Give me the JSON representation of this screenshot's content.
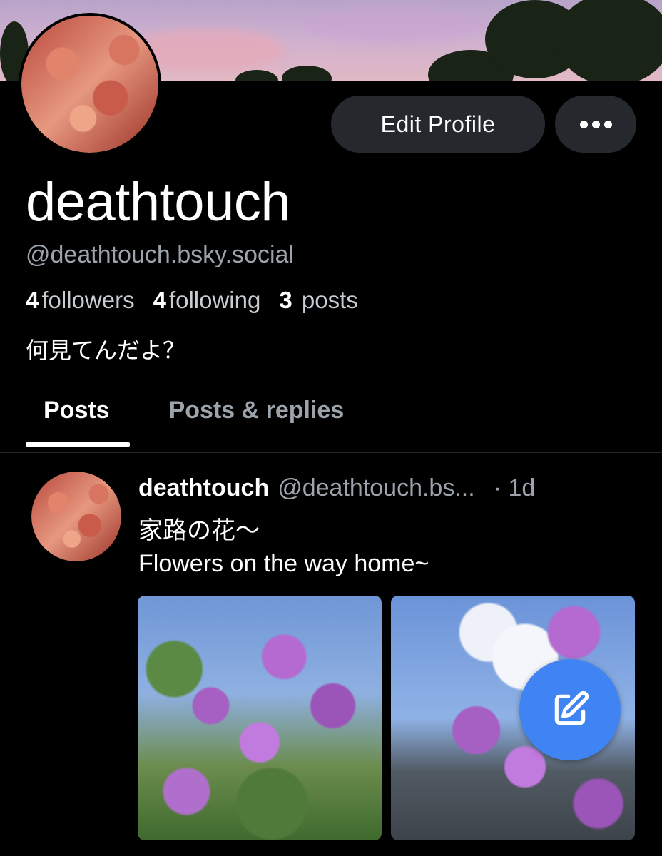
{
  "profile": {
    "display_name": "deathtouch",
    "handle": "@deathtouch.bsky.social",
    "followers_count": "4",
    "followers_label": "followers",
    "following_count": "4",
    "following_label": "following",
    "posts_count": "3",
    "posts_label": "posts",
    "bio": "何見てんだよ？"
  },
  "actions": {
    "edit_profile_label": "Edit Profile",
    "more_icon": "ellipsis-icon"
  },
  "tabs": [
    {
      "label": "Posts",
      "active": true
    },
    {
      "label": "Posts & replies",
      "active": false
    }
  ],
  "feed": [
    {
      "author": "deathtouch",
      "handle": "@deathtouch.bs...",
      "time": "· 1d",
      "text_line1": "家路の花〜",
      "text_line2": "Flowers on the way home~",
      "image_count": 2
    }
  ],
  "fab": {
    "icon": "compose-icon",
    "color": "#3f84f2"
  },
  "colors": {
    "background": "#000000",
    "button": "#25282d",
    "muted_text": "#9ca3ab",
    "accent": "#3f84f2"
  }
}
